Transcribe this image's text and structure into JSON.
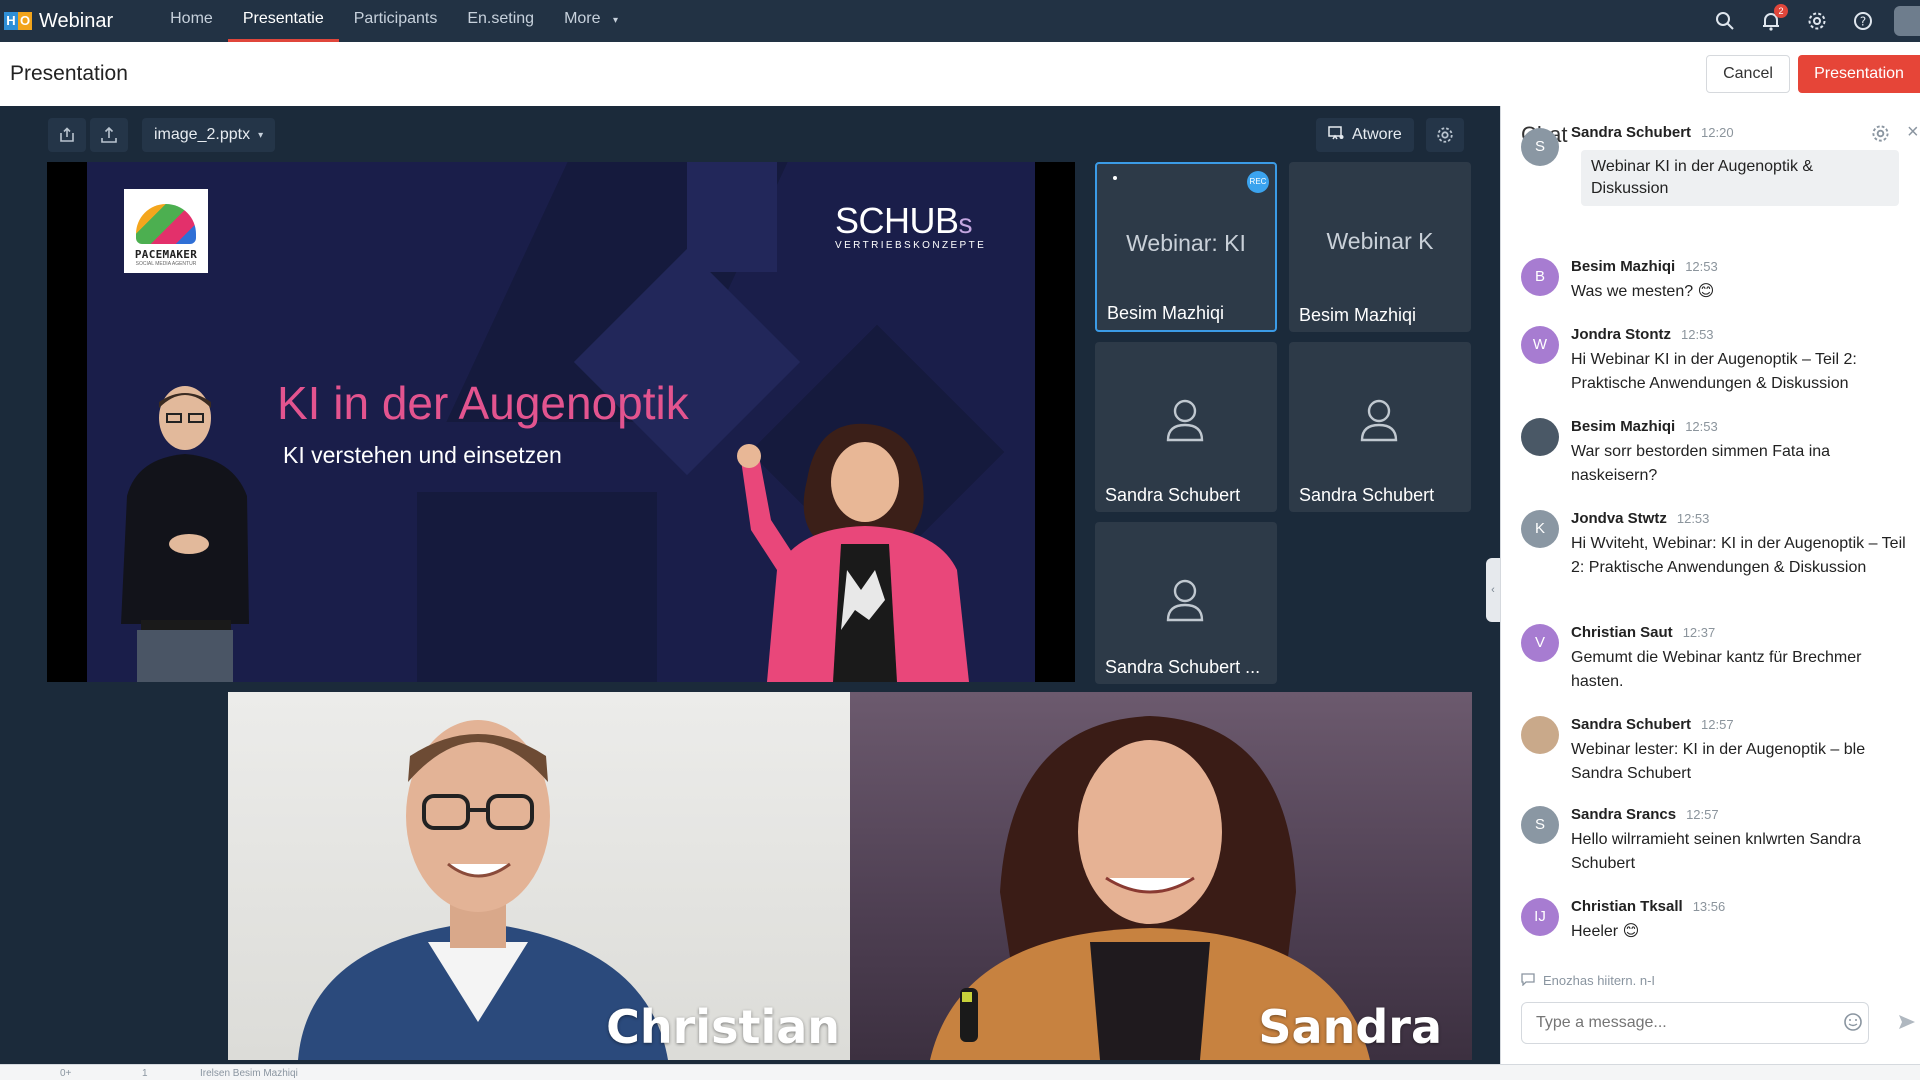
{
  "app": {
    "logo_letters": [
      "H",
      "O"
    ],
    "title": "Webinar"
  },
  "nav": {
    "items": [
      {
        "label": "Home",
        "active": false
      },
      {
        "label": "Presentatie",
        "active": true
      },
      {
        "label": "Participants",
        "active": false
      },
      {
        "label": "En.seting",
        "active": false
      },
      {
        "label": "More",
        "active": false
      }
    ],
    "notification_count": "2",
    "icons": [
      "search-icon",
      "bell-icon",
      "gear-icon",
      "help-icon"
    ]
  },
  "subheader": {
    "title": "Presentation",
    "cancel_label": "Cancel",
    "present_label": "Presentation"
  },
  "toolbar": {
    "file_name": "image_2.pptx",
    "awore_label": "Atwore"
  },
  "slide": {
    "logo_text": "PACEMAKER",
    "logo_subtext": "SOCIAL MEDIA AGENTUR",
    "brand_main": "SCHUB",
    "brand_s": "s",
    "brand_sub": "VERTRIEBSKONZEPTE",
    "title": "KI in der Augenoptik",
    "subtitle": "KI verstehen und einsetzen"
  },
  "participants": [
    {
      "name": "Besim Mazhiqi",
      "screen_text": "Webinar: KI",
      "type": "screen",
      "selected": true,
      "badge": "REC"
    },
    {
      "name": "Besim Mazhiqi",
      "screen_text": "Webinar K",
      "type": "screen",
      "selected": false
    },
    {
      "name": "Sandra Schubert",
      "type": "avatar",
      "selected": false
    },
    {
      "name": "Sandra Schubert",
      "type": "avatar",
      "selected": false
    },
    {
      "name": "Sandra Schubert ...",
      "type": "avatar",
      "selected": false
    }
  ],
  "videos": [
    {
      "name": "Christian"
    },
    {
      "name": "Sandra"
    }
  ],
  "chat": {
    "title": "Chat",
    "messages": [
      {
        "author": "Sandra Schubert",
        "time": "12:20",
        "initial": "S",
        "color": "#8a97a3",
        "text": "Webinar KI in der Augenoptik & Diskussion",
        "bubble": true
      },
      {
        "author": "Besim Mazhiqi",
        "time": "12:53",
        "initial": "B",
        "color": "#a77cd1",
        "text": "Was we mesten? 😊"
      },
      {
        "author": "Jondra Stontz",
        "time": "12:53",
        "initial": "W",
        "color": "#a77cd1",
        "text": "Hi Webinar KI in der Augenoptik – Teil 2: Praktische Anwendungen & Diskussion"
      },
      {
        "author": "Besim Mazhiqi",
        "time": "12:53",
        "initial": "",
        "color": "#4a5866",
        "text": "War sorr bestorden simmen Fata ina naskeisern?"
      },
      {
        "author": "Jondva Stwtz",
        "time": "12:53",
        "initial": "K",
        "color": "#8a97a3",
        "text": "Hi Wviteht, Webinar: KI in der Augenoptik – Teil 2: Praktische Anwendungen & Diskussion"
      },
      {
        "author": "Christian Saut",
        "time": "12:37",
        "initial": "V",
        "color": "#a77cd1",
        "text": "Gemumt die Webinar kantz für Brechmer hasten."
      },
      {
        "author": "Sandra Schubert",
        "time": "12:57",
        "initial": "",
        "color": "#c9a98a",
        "text": "Webinar lester: KI in der Augenoptik – ble Sandra Schubert"
      },
      {
        "author": "Sandra Srancs",
        "time": "12:57",
        "initial": "S",
        "color": "#8a97a3",
        "text": "Hello wilrramieht seinen knlwrten Sandra Schubert"
      },
      {
        "author": "Christian Tksall",
        "time": "13:56",
        "initial": "IJ",
        "color": "#a77cd1",
        "text": "Heeler 😊"
      }
    ],
    "typing_hint": "Enozhas hiitern. n-I",
    "input_placeholder": "Type a message..."
  },
  "statusbar": {
    "left_item_1": "0+",
    "left_item_2": "1",
    "left_item_3": "Irelsen Besim Mazhiqi"
  }
}
